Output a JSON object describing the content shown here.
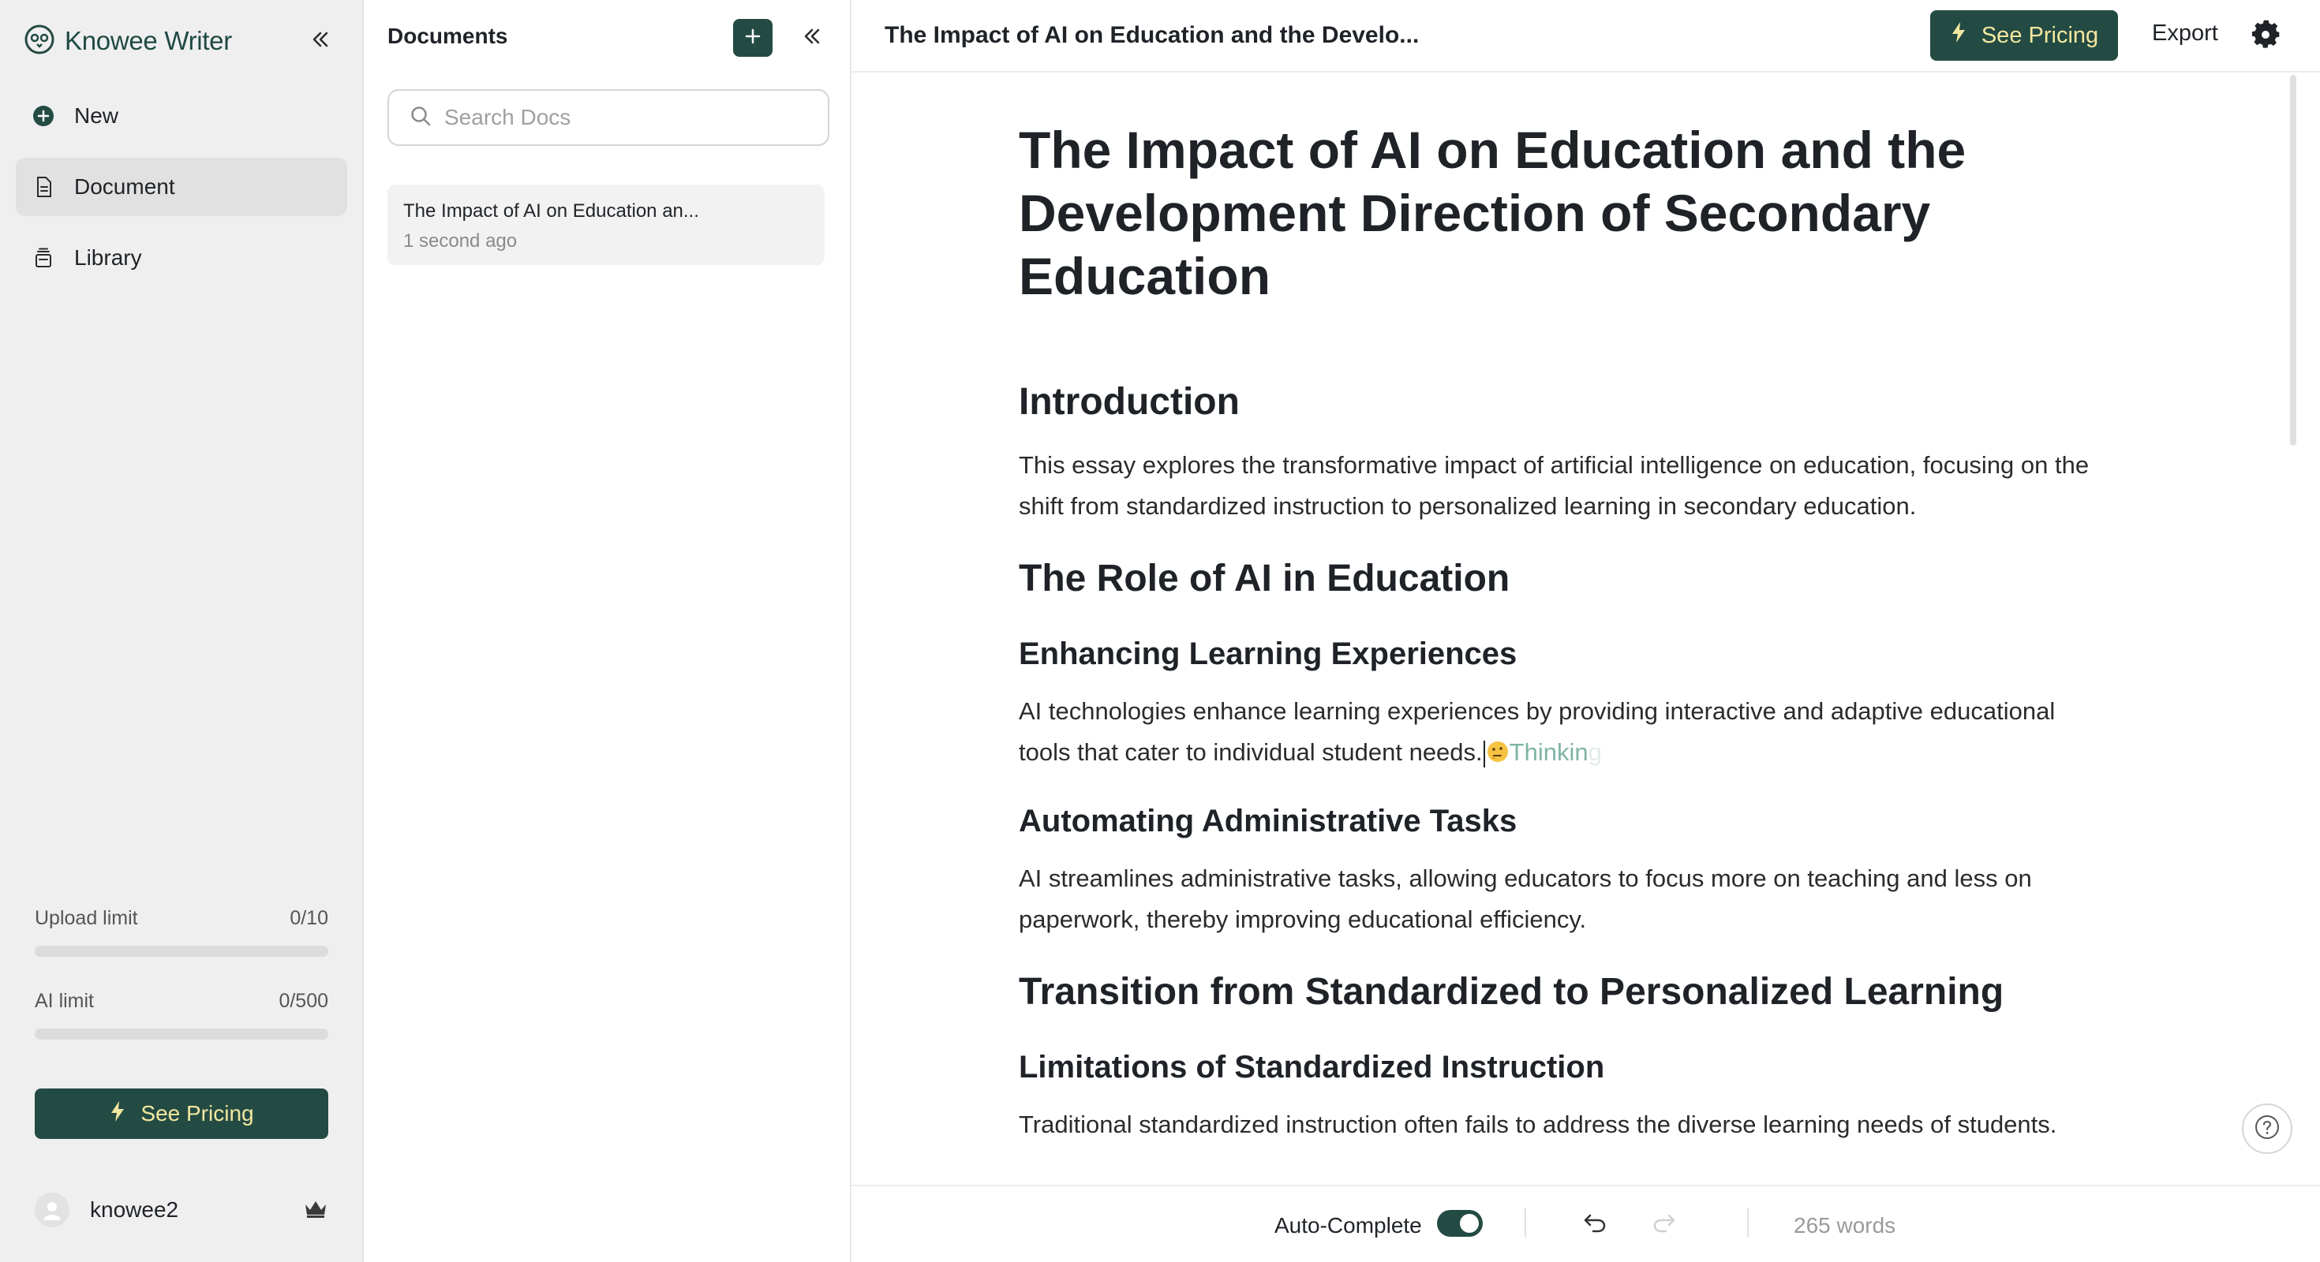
{
  "app": {
    "name": "Knowee Writer"
  },
  "nav": {
    "items": [
      {
        "label": "New",
        "icon": "plus-circle-icon"
      },
      {
        "label": "Document",
        "icon": "document-icon",
        "active": true
      },
      {
        "label": "Library",
        "icon": "library-icon"
      }
    ]
  },
  "limits": {
    "upload": {
      "label": "Upload limit",
      "value": "0/10",
      "fraction": 0
    },
    "ai": {
      "label": "AI limit",
      "value": "0/500",
      "fraction": 0
    }
  },
  "sidebar": {
    "pricing_label": "See Pricing",
    "username": "knowee2"
  },
  "docs_panel": {
    "title": "Documents",
    "search_placeholder": "Search Docs",
    "items": [
      {
        "title": "The Impact of AI on Education an...",
        "time": "1 second ago"
      }
    ]
  },
  "topbar": {
    "doc_title": "The Impact of AI on Education and the Develo...",
    "pricing_label": "See Pricing",
    "export_label": "Export"
  },
  "document": {
    "title": "The Impact of AI on Education and the Development Direction of Secondary Education",
    "intro_heading": "Introduction",
    "intro_text": "This essay explores the transformative impact of artificial intelligence on education, focusing on the shift from standardized instruction to personalized learning in secondary education.",
    "role_heading": "The Role of AI in Education",
    "enhancing_heading": "Enhancing Learning Experiences",
    "enhancing_text": "AI technologies enhance learning experiences by providing interactive and adaptive educational tools that cater to individual student needs.",
    "thinking_text": "Thinkin",
    "thinking_fade": "g",
    "automating_heading": "Automating Administrative Tasks",
    "automating_text": "AI streamlines administrative tasks, allowing educators to focus more on teaching and less on paperwork, thereby improving educational efficiency.",
    "transition_heading": "Transition from Standardized to Personalized Learning",
    "limitations_heading": "Limitations of Standardized Instruction",
    "limitations_text": "Traditional standardized instruction often fails to address the diverse learning needs of students."
  },
  "bottombar": {
    "autocomplete_label": "Auto-Complete",
    "autocomplete_on": true,
    "word_count": "265 words"
  },
  "colors": {
    "brand": "#234b43",
    "pricing_text": "#f4e7a0",
    "thinking": "#7fb4a6"
  }
}
